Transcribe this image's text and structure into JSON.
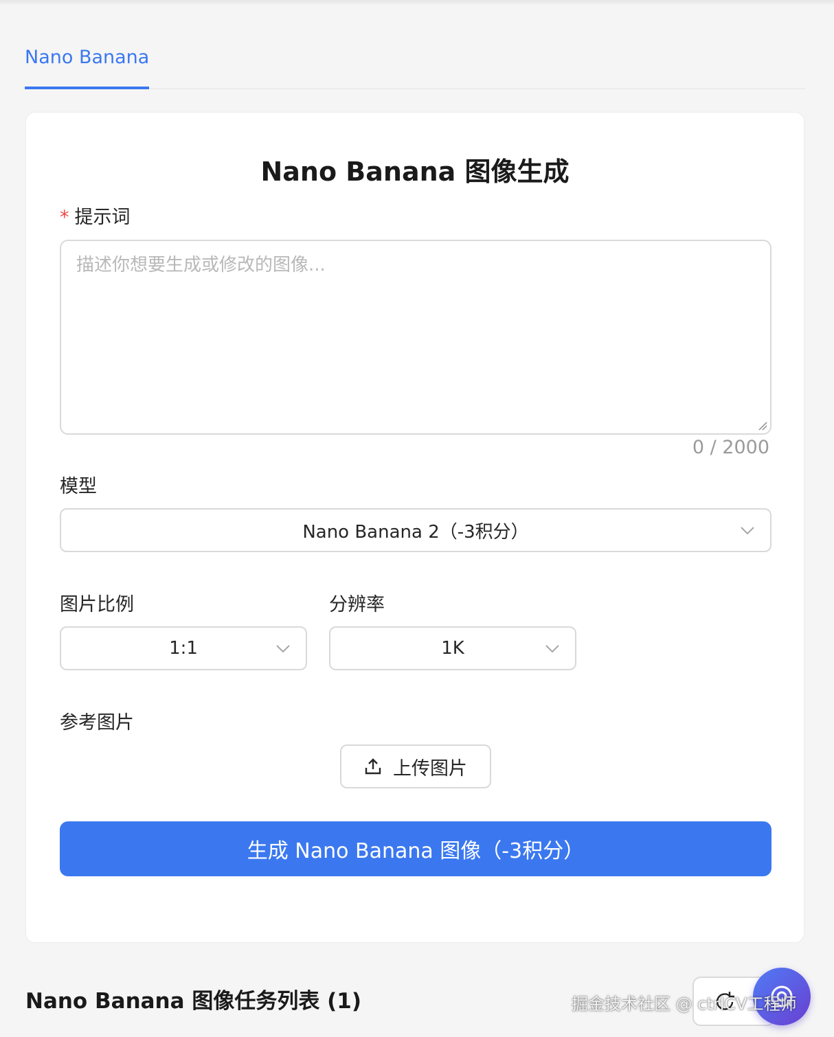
{
  "tabs": [
    {
      "label": "Nano Banana",
      "active": true
    }
  ],
  "form": {
    "title": "Nano Banana 图像生成",
    "prompt": {
      "required_mark": "*",
      "label": "提示词",
      "placeholder": "描述你想要生成或修改的图像...",
      "value": "",
      "counter": "0 / 2000"
    },
    "model": {
      "label": "模型",
      "selected": "Nano Banana 2（-3积分）"
    },
    "aspect_ratio": {
      "label": "图片比例",
      "selected": "1:1"
    },
    "resolution": {
      "label": "分辨率",
      "selected": "1K"
    },
    "reference": {
      "label": "参考图片",
      "upload_label": "上传图片",
      "upload_icon": "upload-icon"
    },
    "submit_label": "生成 Nano Banana 图像（-3积分）"
  },
  "task_list": {
    "title": "Nano Banana 图像任务列表 (1)",
    "refresh_icon": "refresh-icon"
  },
  "watermark": "掘金技术社区 @ ctrlCV工程师",
  "float_icon": "help-icon",
  "colors": {
    "accent": "#3b78f0",
    "required": "#f04848",
    "border": "#d9d9d9",
    "background": "#f5f5f5"
  }
}
